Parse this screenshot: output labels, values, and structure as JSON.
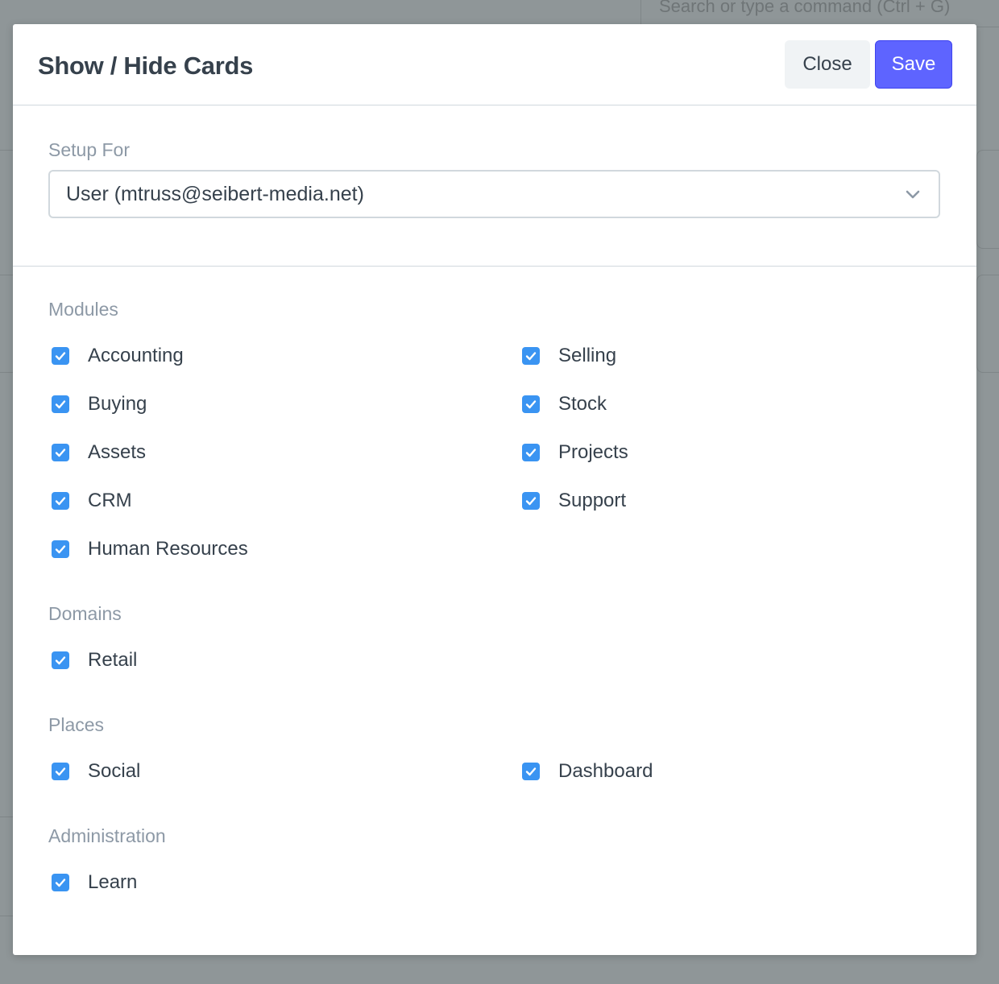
{
  "background": {
    "search_placeholder": "Search or type a command (Ctrl + G)"
  },
  "modal": {
    "title": "Show / Hide Cards",
    "close_label": "Close",
    "save_label": "Save"
  },
  "setup": {
    "label": "Setup For",
    "selected_value": "User (mtruss@seibert-media.net)"
  },
  "groups": {
    "modules": {
      "label": "Modules",
      "items": [
        {
          "label": "Accounting",
          "checked": true
        },
        {
          "label": "Selling",
          "checked": true
        },
        {
          "label": "Buying",
          "checked": true
        },
        {
          "label": "Stock",
          "checked": true
        },
        {
          "label": "Assets",
          "checked": true
        },
        {
          "label": "Projects",
          "checked": true
        },
        {
          "label": "CRM",
          "checked": true
        },
        {
          "label": "Support",
          "checked": true
        },
        {
          "label": "Human Resources",
          "checked": true
        }
      ]
    },
    "domains": {
      "label": "Domains",
      "items": [
        {
          "label": "Retail",
          "checked": true
        }
      ]
    },
    "places": {
      "label": "Places",
      "items": [
        {
          "label": "Social",
          "checked": true
        },
        {
          "label": "Dashboard",
          "checked": true
        }
      ]
    },
    "administration": {
      "label": "Administration",
      "items": [
        {
          "label": "Learn",
          "checked": true
        }
      ]
    }
  },
  "colors": {
    "primary": "#5e64ff",
    "checkbox": "#3a94f2",
    "text": "#36414c",
    "muted": "#8d99a6"
  }
}
